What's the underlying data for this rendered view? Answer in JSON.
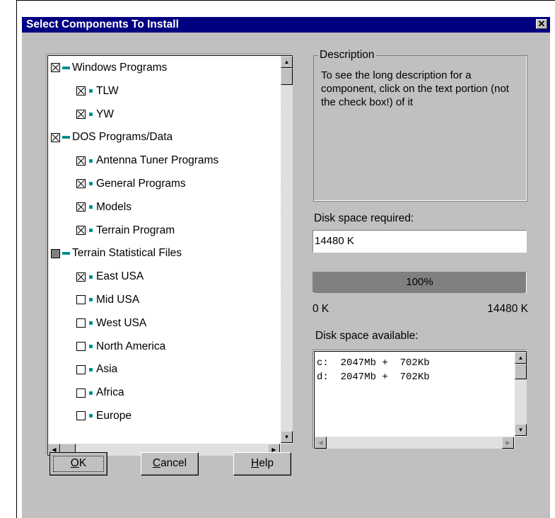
{
  "dialog": {
    "title": "Select Components To Install",
    "close_glyph": "✕"
  },
  "tree": [
    {
      "label": "Windows Programs",
      "level": 0,
      "state": "checked",
      "node": "expanded"
    },
    {
      "label": "TLW",
      "level": 1,
      "state": "checked",
      "node": "leaf"
    },
    {
      "label": "YW",
      "level": 1,
      "state": "checked",
      "node": "leaf"
    },
    {
      "label": "DOS Programs/Data",
      "level": 0,
      "state": "checked",
      "node": "expanded"
    },
    {
      "label": "Antenna Tuner Programs",
      "level": 1,
      "state": "checked",
      "node": "leaf"
    },
    {
      "label": "General Programs",
      "level": 1,
      "state": "checked",
      "node": "leaf"
    },
    {
      "label": "Models",
      "level": 1,
      "state": "checked",
      "node": "leaf"
    },
    {
      "label": "Terrain Program",
      "level": 1,
      "state": "checked",
      "node": "leaf"
    },
    {
      "label": "Terrain Statistical Files",
      "level": 0,
      "state": "partial",
      "node": "expanded"
    },
    {
      "label": "East USA",
      "level": 1,
      "state": "checked",
      "node": "leaf"
    },
    {
      "label": "Mid USA",
      "level": 1,
      "state": "unchecked",
      "node": "leaf"
    },
    {
      "label": "West USA",
      "level": 1,
      "state": "unchecked",
      "node": "leaf"
    },
    {
      "label": "North America",
      "level": 1,
      "state": "unchecked",
      "node": "leaf"
    },
    {
      "label": "Asia",
      "level": 1,
      "state": "unchecked",
      "node": "leaf"
    },
    {
      "label": "Africa",
      "level": 1,
      "state": "unchecked",
      "node": "leaf"
    },
    {
      "label": "Europe",
      "level": 1,
      "state": "unchecked",
      "node": "leaf"
    }
  ],
  "description": {
    "group_label": "Description",
    "text": "To see the long description for a component, click on the text portion (not the check box!) of it"
  },
  "disk_required": {
    "label": "Disk space required:",
    "value": "14480 K"
  },
  "progress": {
    "percent_label": "100%",
    "fraction": 1.0,
    "min_label": "0 K",
    "max_label": "14480 K"
  },
  "disk_available": {
    "label": "Disk space available:",
    "lines": [
      "c:  2047Mb +  702Kb",
      "d:  2047Mb +  702Kb"
    ]
  },
  "buttons": {
    "ok": {
      "prefix": "",
      "accel": "O",
      "rest": "K"
    },
    "cancel": {
      "prefix": "",
      "accel": "C",
      "rest": "ancel"
    },
    "help": {
      "prefix": "",
      "accel": "H",
      "rest": "elp"
    }
  },
  "scroll_glyphs": {
    "up": "▲",
    "down": "▼",
    "left": "◀",
    "right": "▶"
  }
}
